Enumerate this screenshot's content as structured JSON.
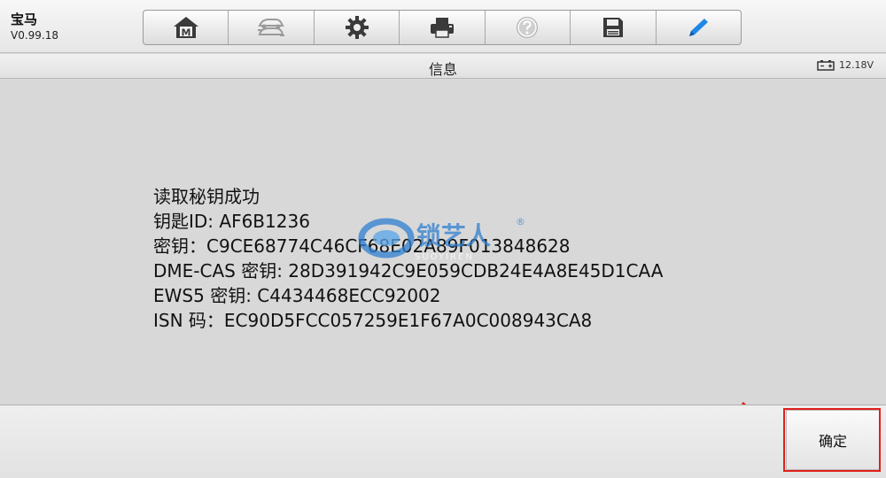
{
  "app": {
    "title": "宝马",
    "version": "V0.99.18"
  },
  "toolbar": {
    "buttons": [
      {
        "icon": "home-icon",
        "label": "M"
      },
      {
        "icon": "vehicle-swap-icon"
      },
      {
        "icon": "gear-icon"
      },
      {
        "icon": "printer-icon"
      },
      {
        "icon": "help-icon"
      },
      {
        "icon": "save-icon"
      },
      {
        "icon": "pen-icon"
      }
    ]
  },
  "titlebar": {
    "title": "信息",
    "voltage": "12.18V",
    "battery_icon": "battery-icon"
  },
  "content": {
    "lines": [
      "读取秘钥成功",
      "钥匙ID: AF6B1236",
      "密钥：C9CE68774C46CF68E02A89F013848628",
      "DME-CAS 密钥: 28D391942C9E059CDB24E4A8E45D1CAA",
      "EWS5 密钥: C4434468ECC92002",
      "ISN 码：EC90D5FCC057259E1F67A0C008943CA8"
    ]
  },
  "watermark": {
    "text": "锁艺人",
    "mark": "®",
    "subtext": "SUOYIREN"
  },
  "footer": {
    "confirm_label": "确定"
  },
  "colors": {
    "highlight": "#e0201b",
    "pen_blue": "#1e88e5",
    "background": "#d8d8d8"
  }
}
